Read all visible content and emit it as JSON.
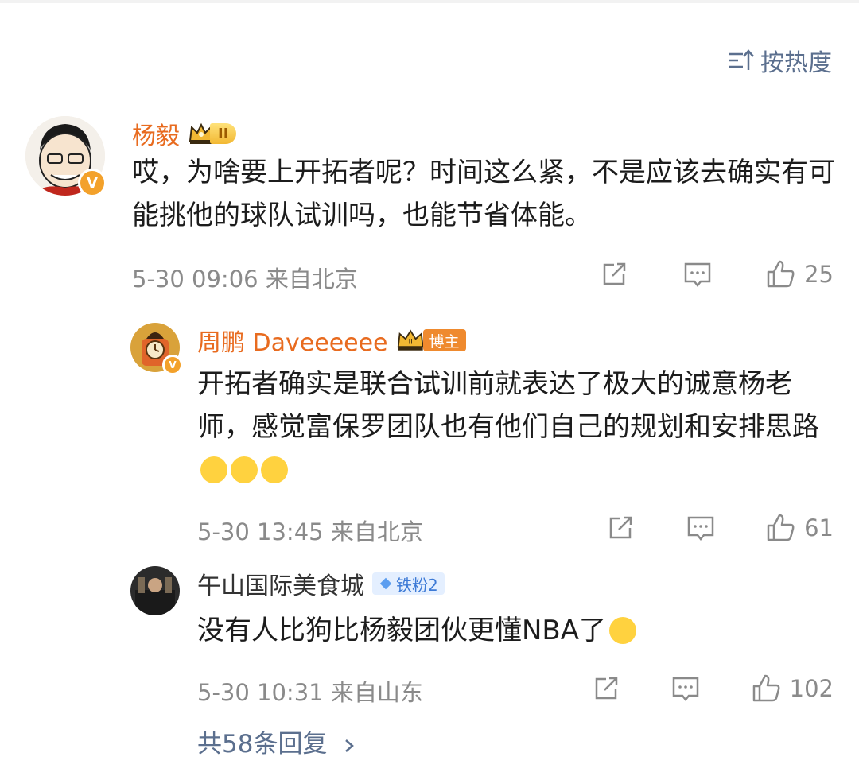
{
  "sort": {
    "label": "按热度"
  },
  "comments": [
    {
      "name": "杨毅",
      "level": "II",
      "text": "哎，为啥要上开拓者呢？时间这么紧，不是应该去确实有可能挑他的球队试训吗，也能节省体能。",
      "time": "5-30 09:06",
      "location": "来自北京",
      "likes": "25"
    },
    {
      "name": "周鹏 Daveeeeee",
      "badge": "博主",
      "text": "开拓者确实是联合试训前就表达了极大的诚意杨老师，感觉富保罗团队也有他们自己的规划和安排思路",
      "time": "5-30 13:45",
      "location": "来自北京",
      "likes": "61"
    },
    {
      "name": "午山国际美食城",
      "badge": "铁粉2",
      "text": "没有人比狗比杨毅团伙更懂NBA了",
      "time": "5-30 10:31",
      "location": "来自山东",
      "likes": "102"
    }
  ],
  "more_replies": "共58条回复",
  "colors": {
    "accent_link": "#5b6f8e",
    "name_orange": "#e86b1f",
    "meta_gray": "#8a8a8a"
  },
  "icons": [
    "sort-icon",
    "share-icon",
    "comment-icon",
    "like-icon",
    "verified-icon",
    "crown-icon",
    "chevron-right-icon"
  ]
}
